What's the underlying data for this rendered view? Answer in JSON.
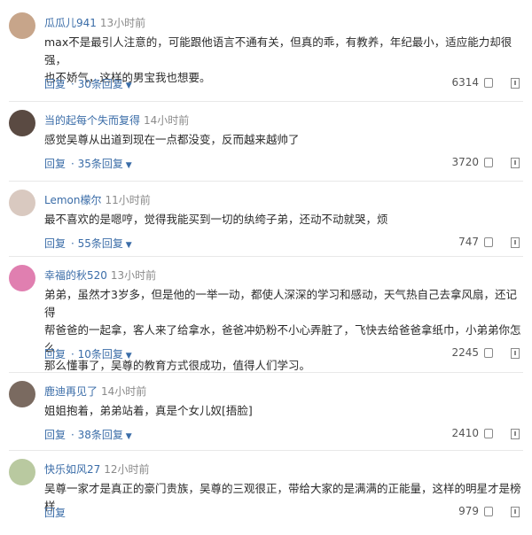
{
  "comments": [
    {
      "username": "瓜瓜儿941",
      "time": "13小时前",
      "lines": [
        "max不是最引人注意的，可能跟他语言不通有关，但真的乖，有教养，年纪最小，适应能力却很强，",
        "也不娇气，这样的男宝我也想要。"
      ],
      "reply_label": "回复",
      "more_replies": "30条回复",
      "likes": "6314",
      "avatar_color": "#c7a58a"
    },
    {
      "username": "当的起每个失而复得",
      "time": "14小时前",
      "lines": [
        "感觉吴尊从出道到现在一点都没变，反而越来越帅了"
      ],
      "reply_label": "回复",
      "more_replies": "35条回复",
      "likes": "3720",
      "avatar_color": "#5a4a42"
    },
    {
      "username": "Lemon檬尔",
      "time": "11小时前",
      "lines": [
        "最不喜欢的是嗯哼，觉得我能买到一切的纨绔子弟，还动不动就哭，烦"
      ],
      "reply_label": "回复",
      "more_replies": "55条回复",
      "likes": "747",
      "avatar_color": "#d9c9c0"
    },
    {
      "username": "幸福的秋520",
      "time": "13小时前",
      "lines": [
        "弟弟，虽然才3岁多，但是他的一举一动，都使人深深的学习和感动，天气热自己去拿风扇，还记得",
        "帮爸爸的一起拿，客人来了给拿水，爸爸冲奶粉不小心弄脏了，飞快去给爸爸拿纸巾，小弟弟你怎么",
        "那么懂事了，吴尊的教育方式很成功，值得人们学习。"
      ],
      "reply_label": "回复",
      "more_replies": "10条回复",
      "likes": "2245",
      "avatar_color": "#e07fb0"
    },
    {
      "username": "鹿迪再见了",
      "time": "14小时前",
      "lines": [
        "姐姐抱着，弟弟站着，真是个女儿奴[捂脸]"
      ],
      "reply_label": "回复",
      "more_replies": "38条回复",
      "likes": "2410",
      "avatar_color": "#7a6a60"
    },
    {
      "username": "快乐如风27",
      "time": "12小时前",
      "lines": [
        "吴尊一家才是真正的豪门贵族，吴尊的三观很正，带给大家的是满满的正能量，这样的明星才是榜样"
      ],
      "reply_label": "回复",
      "more_replies": "",
      "likes": "979",
      "avatar_color": "#b9c9a0"
    }
  ]
}
